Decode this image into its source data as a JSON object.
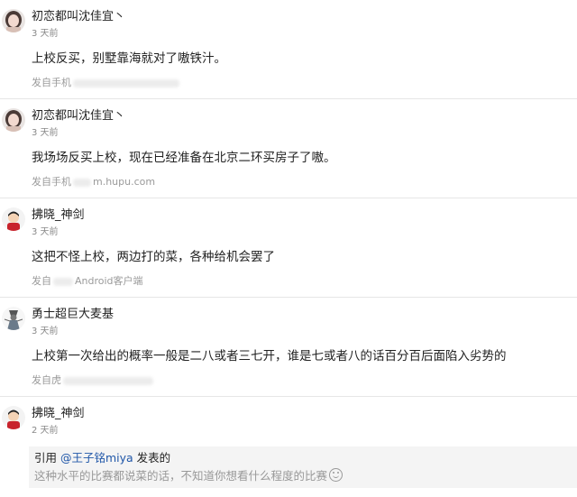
{
  "comments": [
    {
      "user": "初恋都叫沈佳宜丶",
      "time": "3 天前",
      "content": "上校反买，别墅靠海就对了嗷铁汁。",
      "source": "发自手机"
    },
    {
      "user": "初恋都叫沈佳宜丶",
      "time": "3 天前",
      "content": "我场场反买上校，现在已经准备在北京二环买房子了嗷。",
      "source": "发自手机",
      "source_tail": "m.hupu.com"
    },
    {
      "user": "拂晓_神剑",
      "time": "3 天前",
      "content": "这把不怪上校，两边打的菜，各种给机会罢了",
      "source": "发自",
      "source_tail": "Android客户端"
    },
    {
      "user": "勇士超巨大麦基",
      "time": "3 天前",
      "content": "上校第一次给出的概率一般是二八或者三七开，谁是七或者八的话百分百后面陷入劣势的",
      "source": "发自虎"
    },
    {
      "user": "拂晓_神剑",
      "time": "2 天前",
      "quote": {
        "prefix": "引用 ",
        "user": "@王子铭miya",
        "suffix": " 发表的",
        "body": "这种水平的比赛都说菜的话，不知道你想看什么程度的比赛"
      }
    }
  ]
}
